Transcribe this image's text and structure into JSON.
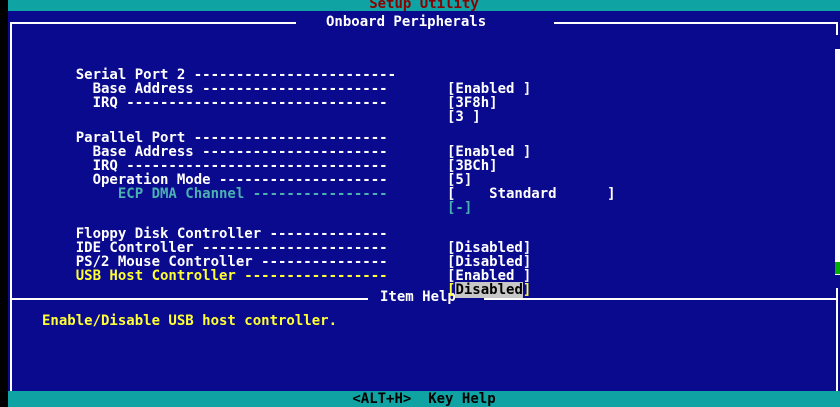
{
  "title": "Setup Utility",
  "section_title": "Onboard Peripherals",
  "help_title": "Item Help",
  "help_text": "Enable/Disable USB host controller.",
  "footer": "<ALT+H>  Key Help",
  "settings": [
    {
      "label": "Serial Port 2 ------------------------",
      "value": "[Enabled ]"
    },
    {
      "label": "  Base Address ----------------------",
      "value": "[3F8h]"
    },
    {
      "label": "  IRQ -------------------------------",
      "value": "[3 ]"
    },
    {
      "label": "Parallel Port -----------------------",
      "value": "[Enabled ]"
    },
    {
      "label": "  Base Address ----------------------",
      "value": "[3BCh]"
    },
    {
      "label": "  IRQ -------------------------------",
      "value": "[5]"
    },
    {
      "label": "  Operation Mode --------------------",
      "value": "[    Standard      ]"
    },
    {
      "label": "     ECP DMA Channel ----------------",
      "value": "[-]"
    },
    {
      "label": "Floppy Disk Controller --------------",
      "value": "[Disabled]"
    },
    {
      "label": "IDE Controller ----------------------",
      "value": "[Disabled]"
    },
    {
      "label": "PS/2 Mouse Controller ---------------",
      "value": "[Enabled ]"
    },
    {
      "label": "USB Host Controller -----------------",
      "value_prefix": "[",
      "value_highlight": "Disabled",
      "value_suffix": "]"
    }
  ]
}
